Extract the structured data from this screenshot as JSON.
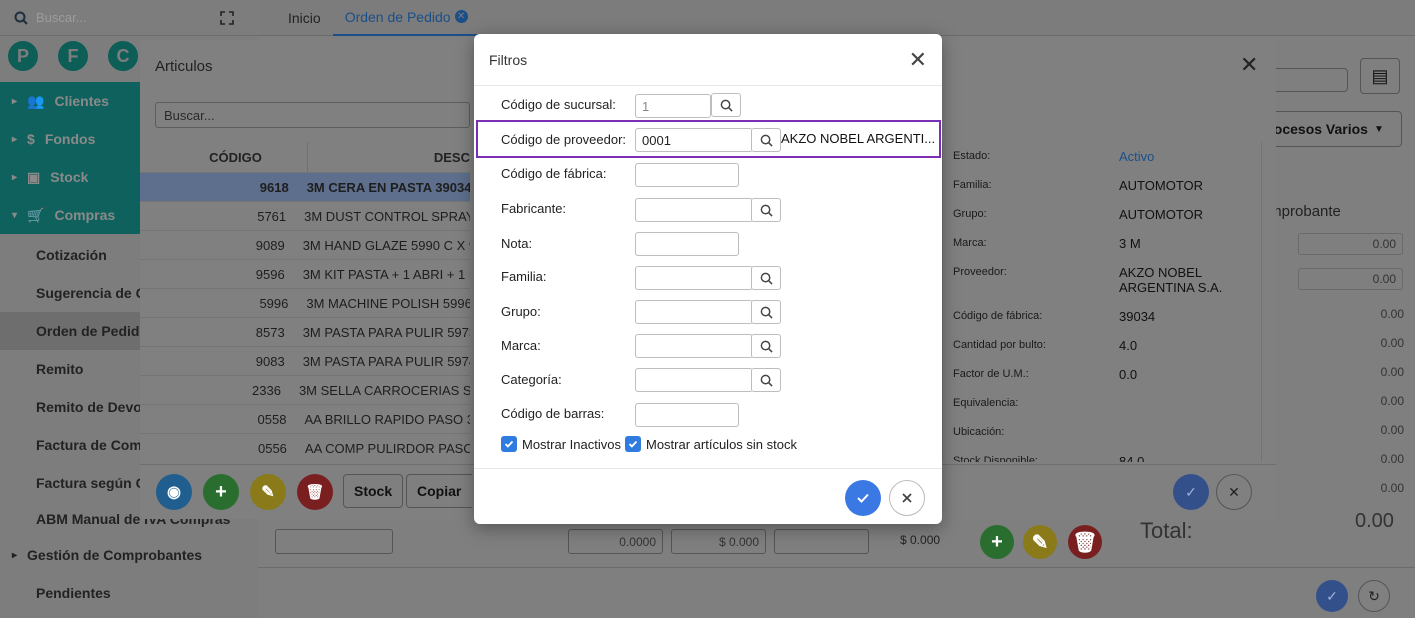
{
  "sidebar": {
    "search_placeholder": "Buscar...",
    "avatars": [
      "P",
      "F",
      "C"
    ],
    "menu": [
      {
        "label": "Clientes",
        "icon": "users-icon"
      },
      {
        "label": "Fondos",
        "icon": "dollar-icon"
      },
      {
        "label": "Stock",
        "icon": "box-icon"
      },
      {
        "label": "Compras",
        "icon": "cart-icon"
      }
    ],
    "submenu": [
      "Cotización",
      "Sugerencia de C",
      "Orden de Pedido",
      "Remito",
      "Remito de Devo",
      "Factura de Com",
      "Factura según C",
      "ABM Manual de IVA Compras"
    ],
    "gestion": "Gestión de Comprobantes",
    "pendientes": "Pendientes"
  },
  "tabs": {
    "inicio": "Inicio",
    "orden": "Orden de Pedido"
  },
  "articulos": {
    "title": "Articulos",
    "search_placeholder": "Buscar...",
    "col_codigo": "CÓDIGO",
    "col_desc": "DESC",
    "rows": [
      {
        "code": "9618",
        "desc": "3M CERA EN PASTA 39034"
      },
      {
        "code": "5761",
        "desc": "3M DUST CONTROL SPRAY"
      },
      {
        "code": "9089",
        "desc": "3M HAND GLAZE 5990 C X 9"
      },
      {
        "code": "9596",
        "desc": "3M KIT PASTA + 1 ABRI + 1 L"
      },
      {
        "code": "5996",
        "desc": "3M MACHINE POLISH 5996"
      },
      {
        "code": "8573",
        "desc": "3M PASTA PARA PULIR 5973"
      },
      {
        "code": "9083",
        "desc": "3M PASTA PARA PULIR 5974"
      },
      {
        "code": "2336",
        "desc": "3M SELLA CARROCERIAS SC"
      },
      {
        "code": "0558",
        "desc": "AA BRILLO RAPIDO PASO 3"
      },
      {
        "code": "0556",
        "desc": "AA COMP PULIRDOR PASO"
      }
    ],
    "btn_stock": "Stock",
    "btn_copiar": "Copiar"
  },
  "detail": {
    "items": [
      {
        "label": "Estado:",
        "value": "Activo"
      },
      {
        "label": "Familia:",
        "value": "AUTOMOTOR"
      },
      {
        "label": "Grupo:",
        "value": "AUTOMOTOR"
      },
      {
        "label": "Marca:",
        "value": "3 M"
      },
      {
        "label": "Proveedor:",
        "value": "AKZO NOBEL ARGENTINA S.A."
      },
      {
        "label": "Código de fábrica:",
        "value": "39034"
      },
      {
        "label": "Cantidad por bulto:",
        "value": "4.0"
      },
      {
        "label": "Factor de U.M.:",
        "value": "0.0"
      },
      {
        "label": "Equivalencia:",
        "value": ""
      },
      {
        "label": "Ubicación:",
        "value": ""
      },
      {
        "label": "Stock Disponible:",
        "value": "84.0"
      }
    ],
    "procesos": "Procesos Varios",
    "comprobante": "Comprobante",
    "amounts": [
      "0.00",
      "0.00",
      "0.00",
      "0.00",
      "0.00",
      "0.00",
      "0.00",
      "0.00",
      "0.00"
    ],
    "total_label": "Total:",
    "total": "0.00",
    "bottom": {
      "qty": "0.0000",
      "price": "$ 0.000",
      "sub": "$ 0.000"
    }
  },
  "filtros": {
    "title": "Filtros",
    "fields": {
      "sucursal_label": "Código de sucursal:",
      "sucursal_value": "1",
      "proveedor_label": "Código de proveedor:",
      "proveedor_value": "0001",
      "proveedor_name": "AKZO NOBEL ARGENTI...",
      "fabrica_label": "Código de fábrica:",
      "fabricante_label": "Fabricante:",
      "nota_label": "Nota:",
      "familia_label": "Familia:",
      "grupo_label": "Grupo:",
      "marca_label": "Marca:",
      "categoria_label": "Categoría:",
      "barras_label": "Código de barras:"
    },
    "chk_inactivos": "Mostrar Inactivos",
    "chk_sinstock": "Mostrar artículos sin stock",
    "highlight_color": "#7b2fb5",
    "accent": "#3a78e4"
  }
}
